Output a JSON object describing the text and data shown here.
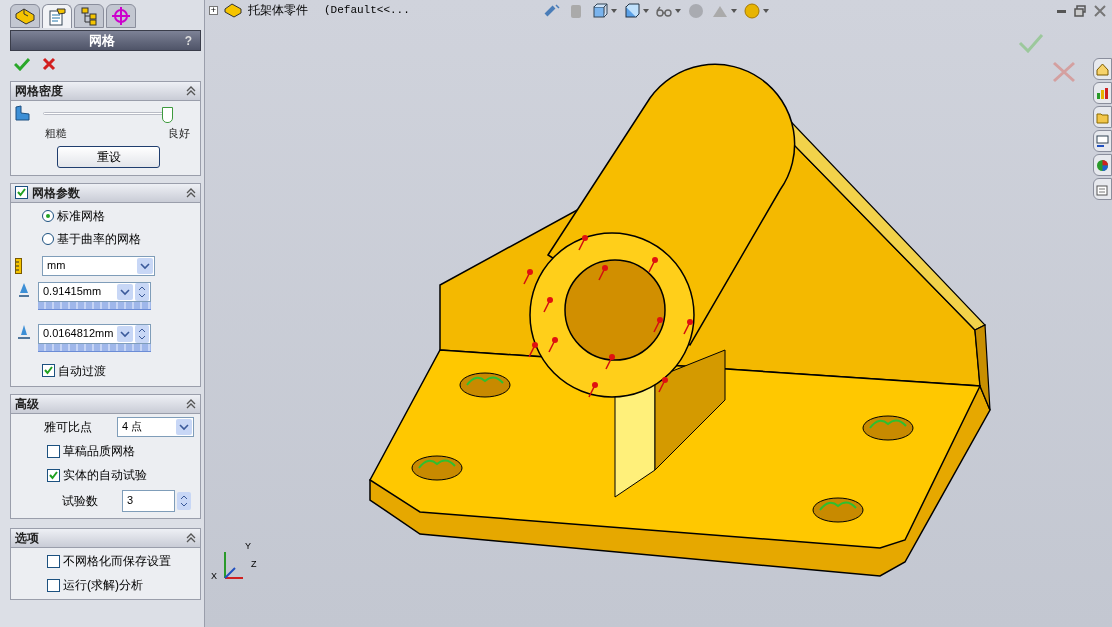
{
  "panel_tabs": [
    {
      "kind": "feature",
      "selected": false
    },
    {
      "kind": "property",
      "selected": true
    },
    {
      "kind": "config",
      "selected": false
    },
    {
      "kind": "target",
      "selected": false
    }
  ],
  "panel": {
    "title": "网格",
    "help": "?"
  },
  "mesh_density": {
    "title": "网格密度",
    "level": 1.0,
    "min_label": "粗糙",
    "max_label": "良好",
    "reset": "重设"
  },
  "mesh_parameters": {
    "title": "网格参数",
    "checked": true,
    "radios": [
      {
        "label": "标准网格",
        "selected": true
      },
      {
        "label": "基于曲率的网格",
        "selected": false
      }
    ],
    "unit": "mm",
    "global_size": {
      "value": "0.91415mm",
      "level": 1.0
    },
    "tolerance": {
      "value": "0.0164812mm",
      "level": 1.0
    },
    "auto_transition": {
      "label": "自动过渡",
      "checked": true
    }
  },
  "advanced": {
    "title": "高级",
    "jacobian_label": "雅可比点",
    "jacobian_value": "4 点",
    "checkboxes": [
      {
        "label": "草稿品质网格",
        "checked": false
      },
      {
        "label": "实体的自动试验",
        "checked": true
      }
    ],
    "attempts_label": "试验数",
    "attempts_value": "3"
  },
  "options": {
    "title": "选项",
    "checkboxes": [
      {
        "label": "不网格化而保存设置",
        "checked": false
      },
      {
        "label": "运行(求解)分析",
        "checked": false
      }
    ]
  },
  "tree_header": {
    "expand": "+",
    "part_name": "托架体零件",
    "configuration": "(Default<<..."
  },
  "triad": {
    "y": "Y",
    "z": "Z",
    "x": "X"
  }
}
